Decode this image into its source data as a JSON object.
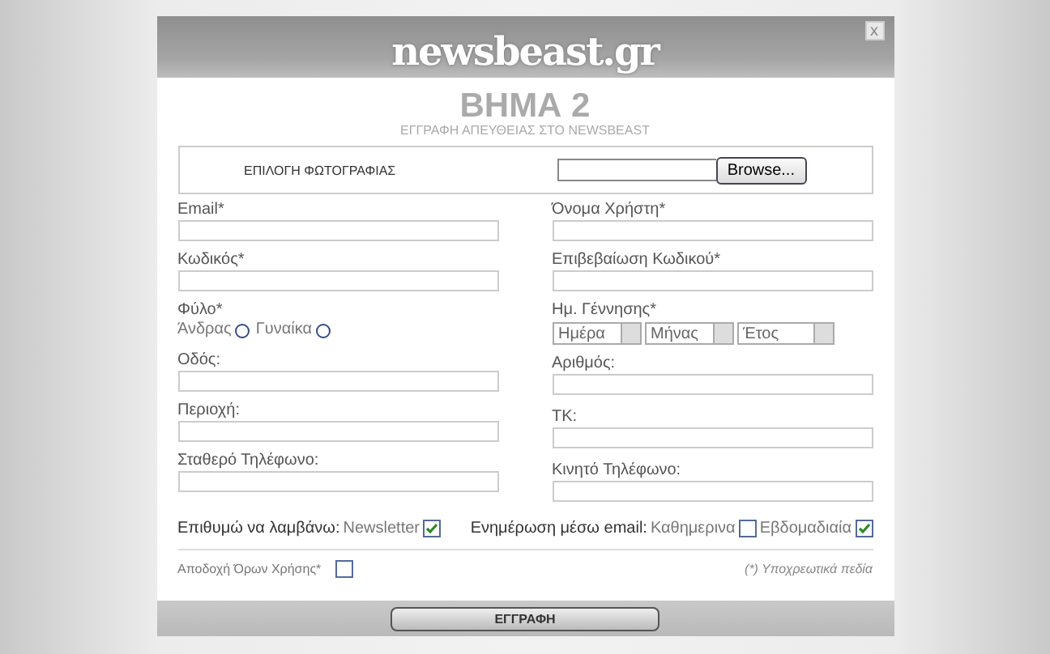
{
  "header": {
    "logo": "newsbeast.gr",
    "close": "x"
  },
  "step": {
    "title": "ΒΗΜΑ 2",
    "subtitle": "ΕΓΓΡΑΦΗ ΑΠΕΥΘΕΙΑΣ ΣΤΟ NEWSBEAST"
  },
  "photo": {
    "label": "ΕΠΙΛΟΓΗ ΦΩΤΟΓΡΑΦΙΑΣ",
    "button": "Browse..."
  },
  "left_column": [
    {
      "kind": "text",
      "label": "Email*"
    },
    {
      "kind": "text",
      "label": "Κωδικός*"
    },
    {
      "kind": "radio",
      "label": "Φύλο*",
      "options": [
        {
          "label": "Άνδρας",
          "selected": false
        },
        {
          "label": "Γυναίκα",
          "selected": false
        }
      ]
    },
    {
      "kind": "text",
      "label": "Οδός:"
    },
    {
      "kind": "text",
      "label": "Περιοχή:"
    },
    {
      "kind": "text",
      "label": "Σταθερό Τηλέφωνο:"
    }
  ],
  "right_column": [
    {
      "kind": "text",
      "label": "Όνομα Χρήστη*"
    },
    {
      "kind": "text",
      "label": "Επιβεβαίωση Κωδικού*"
    },
    {
      "kind": "date",
      "label": "Ημ. Γέννησης*",
      "selects": [
        "Ημέρα",
        "Μήνας",
        "Έτος"
      ]
    },
    {
      "kind": "text",
      "label": "Αριθμός:"
    },
    {
      "kind": "text",
      "label": "ΤΚ:"
    },
    {
      "kind": "text",
      "label": "Κινητό Τηλέφωνο:"
    }
  ],
  "newsletter": {
    "label": "Επιθυμώ να λαμβάνω:",
    "options": [
      {
        "label": "Newsletter",
        "checked": true
      }
    ]
  },
  "email_updates": {
    "label": "Ενημέρωση μέσω email:",
    "options": [
      {
        "label": "Καθημερινα",
        "checked": false
      },
      {
        "label": "Εβδομαδιαία",
        "checked": true
      }
    ]
  },
  "terms": {
    "label": "Αποδοχή Όρων Χρήσης*",
    "checked": false
  },
  "required_note": "(*) Υποχρεωτικά πεδία",
  "submit": "ΕΓΓΡΑΦΗ"
}
